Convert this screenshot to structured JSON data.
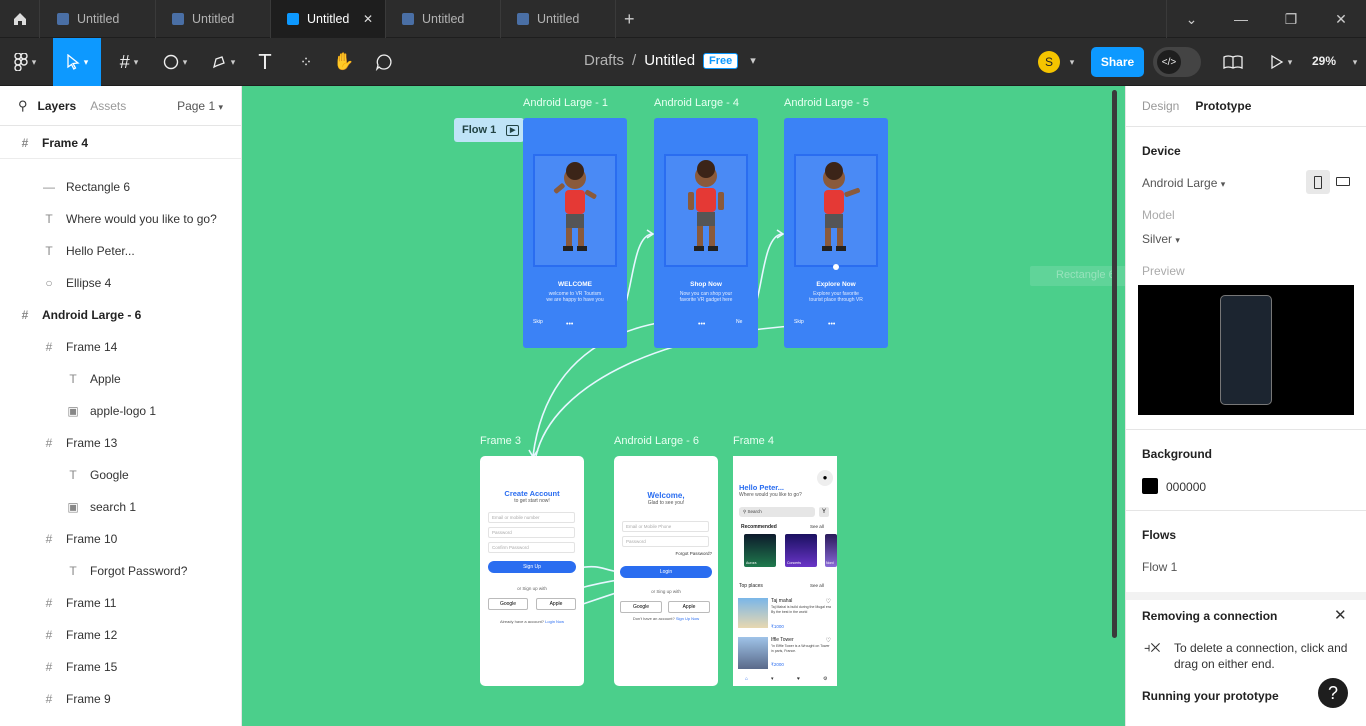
{
  "tabs": [
    "Untitled",
    "Untitled",
    "Untitled",
    "Untitled",
    "Untitled"
  ],
  "active_tab": 2,
  "breadcrumb": {
    "folder": "Drafts",
    "separator": "/",
    "file": "Untitled",
    "badge": "Free"
  },
  "user_initial": "S",
  "share_label": "Share",
  "zoom": "29%",
  "left_panel": {
    "tabs": [
      "Layers",
      "Assets"
    ],
    "page": "Page 1",
    "layers": [
      {
        "name": "Frame 4",
        "icon": "frame-icon",
        "level": 0,
        "bold": true
      },
      {
        "name": "Rectangle 6",
        "icon": "rectangle-icon",
        "level": 1
      },
      {
        "name": "Where would you like to go?",
        "icon": "text-icon",
        "level": 1
      },
      {
        "name": "Hello Peter...",
        "icon": "text-icon",
        "level": 1
      },
      {
        "name": "Ellipse 4",
        "icon": "ellipse-icon",
        "level": 1
      },
      {
        "name": "Android Large - 6",
        "icon": "frame-icon",
        "level": 0,
        "bold": true
      },
      {
        "name": "Frame 14",
        "icon": "frame-icon",
        "level": 1
      },
      {
        "name": "Apple",
        "icon": "text-icon",
        "level": 2
      },
      {
        "name": "apple-logo 1",
        "icon": "image-icon",
        "level": 2
      },
      {
        "name": "Frame 13",
        "icon": "frame-icon",
        "level": 1
      },
      {
        "name": "Google",
        "icon": "text-icon",
        "level": 2
      },
      {
        "name": "search 1",
        "icon": "image-icon",
        "level": 2
      },
      {
        "name": "Frame 10",
        "icon": "frame-icon",
        "level": 1
      },
      {
        "name": "Forgot Password?",
        "icon": "text-icon",
        "level": 2
      },
      {
        "name": "Frame 11",
        "icon": "frame-icon",
        "level": 1
      },
      {
        "name": "Frame 12",
        "icon": "frame-icon",
        "level": 1
      },
      {
        "name": "Frame 15",
        "icon": "frame-icon",
        "level": 1
      },
      {
        "name": "Frame 9",
        "icon": "frame-icon",
        "level": 1
      }
    ]
  },
  "canvas": {
    "flow_tag": "Flow 1",
    "frames_top": [
      {
        "label": "Android Large - 1",
        "title": "WELCOME",
        "sub1": "welcome to VR Tourism",
        "sub2": "we are happy to have you",
        "skip": "Skip",
        "next": ""
      },
      {
        "label": "Android Large - 4",
        "title": "Shop Now",
        "sub1": "Now you can shop your",
        "sub2": "favorite VR gadget here",
        "skip": "",
        "next": "Ne"
      },
      {
        "label": "Android Large - 5",
        "title": "Explore Now",
        "sub1": "Explore your favorite",
        "sub2": "tourist place through VR",
        "skip": "Skip",
        "next": ""
      }
    ],
    "frame3": {
      "label": "Frame 3",
      "title": "Create Account",
      "sub": "to get start now!",
      "fields": [
        "Email or mobile number",
        "Password",
        "Confirm Password"
      ],
      "signup": "Sign Up",
      "or": "or Sign up with",
      "google": "Google",
      "apple": "Apple",
      "footer": "Already have a account?",
      "footer_link": "Login Now"
    },
    "frame6": {
      "label": "Android Large - 6",
      "title": "Welcome,",
      "sub": "Glad to see you!",
      "fields": [
        "Email or Mobile Phone",
        "Password"
      ],
      "forgot": "Forgot Password?",
      "login": "Login",
      "or": "or Sing up with",
      "google": "Google",
      "apple": "Apple",
      "footer": "Don't have an account?",
      "footer_link": "Sign Up Now"
    },
    "frame4": {
      "label": "Frame 4",
      "title": "Hello Peter...",
      "sub": "Where would you like to go?",
      "search": "Search",
      "recommended": "Recommended",
      "see_all": "See all",
      "cards": [
        "Aurora",
        "Concerts",
        "Nord"
      ],
      "top_places": "Top places",
      "places": [
        {
          "name": "Taj mahal",
          "desc": "Taj Mahal is build during the Mugal era By the best in the world",
          "price": "₹1000"
        },
        {
          "name": "Iffle Tower",
          "desc": "\"in Eiffle Tower is a Wrought on Tower in paris, France.",
          "price": "₹2000"
        }
      ]
    }
  },
  "right_panel": {
    "tabs": [
      "Design",
      "Prototype"
    ],
    "device_heading": "Device",
    "device": "Android Large",
    "model_label": "Model",
    "model": "Silver",
    "preview_label": "Preview",
    "background_heading": "Background",
    "background_hex": "000000",
    "flows_heading": "Flows",
    "flow": "Flow 1",
    "tip_title": "Removing a connection",
    "tip_body": "To delete a connection, click and drag on either end.",
    "running_heading": "Running your prototype",
    "ghost_label": "Rectangle 6"
  },
  "colors": {
    "canvas": "#4bcf8b",
    "accent": "#0d99ff",
    "phone_blue": "#3b82f6"
  }
}
